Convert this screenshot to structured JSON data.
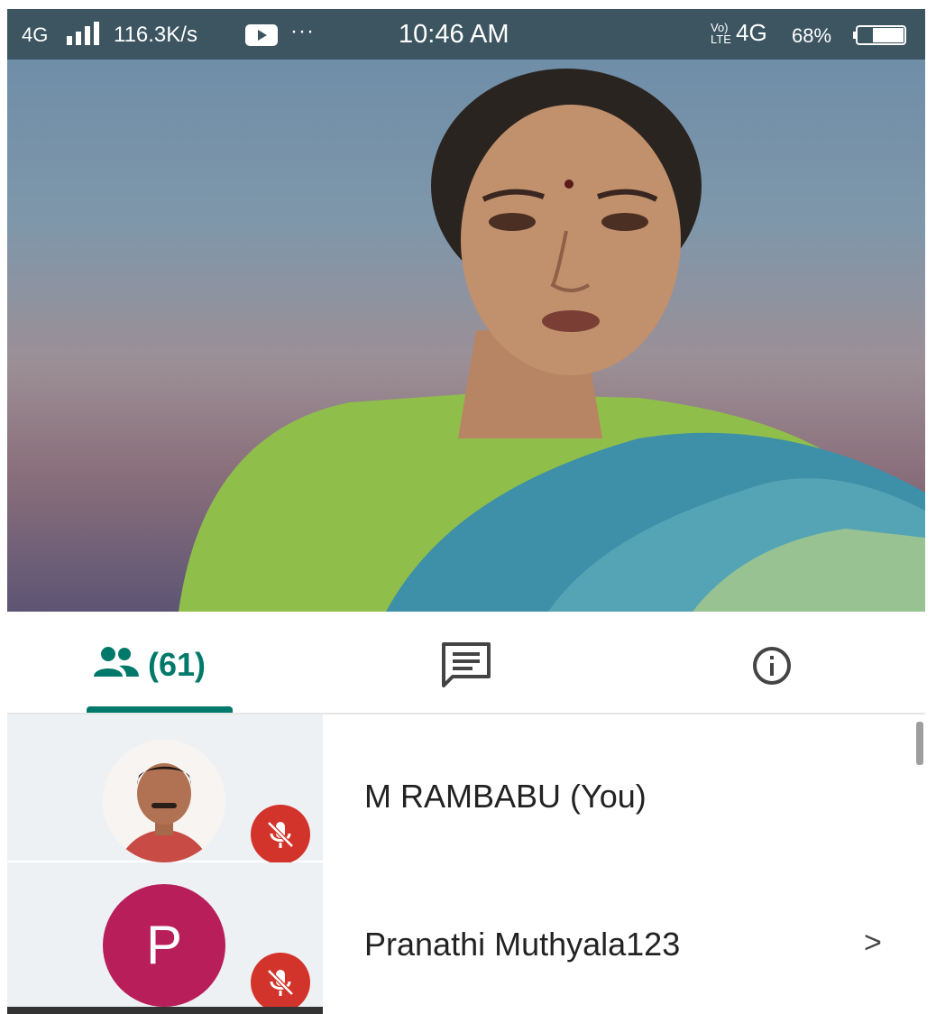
{
  "status_bar": {
    "network_label": "4G",
    "speed": "116.3K/s",
    "dots": "···",
    "time": "10:46 AM",
    "volte_label": "Vo)\nLTE",
    "network2_label": "4G",
    "battery": "68%",
    "icons": [
      "signal-icon",
      "video-notification-icon",
      "battery-icon"
    ]
  },
  "tabs": {
    "people_count": "(61)",
    "icons": [
      "people-icon",
      "chat-icon",
      "info-icon"
    ],
    "accent": "#00796b"
  },
  "participants": [
    {
      "name": "M RAMBABU (You)",
      "avatar": "photo",
      "muted": true
    },
    {
      "name": "Pranathi Muthyala123",
      "avatar_letter": "P",
      "avatar_color": "#b81e5a",
      "muted": true,
      "chevron": ">"
    }
  ],
  "colors": {
    "status_bar": "#3c5561",
    "mute_badge": "#d2342b"
  }
}
